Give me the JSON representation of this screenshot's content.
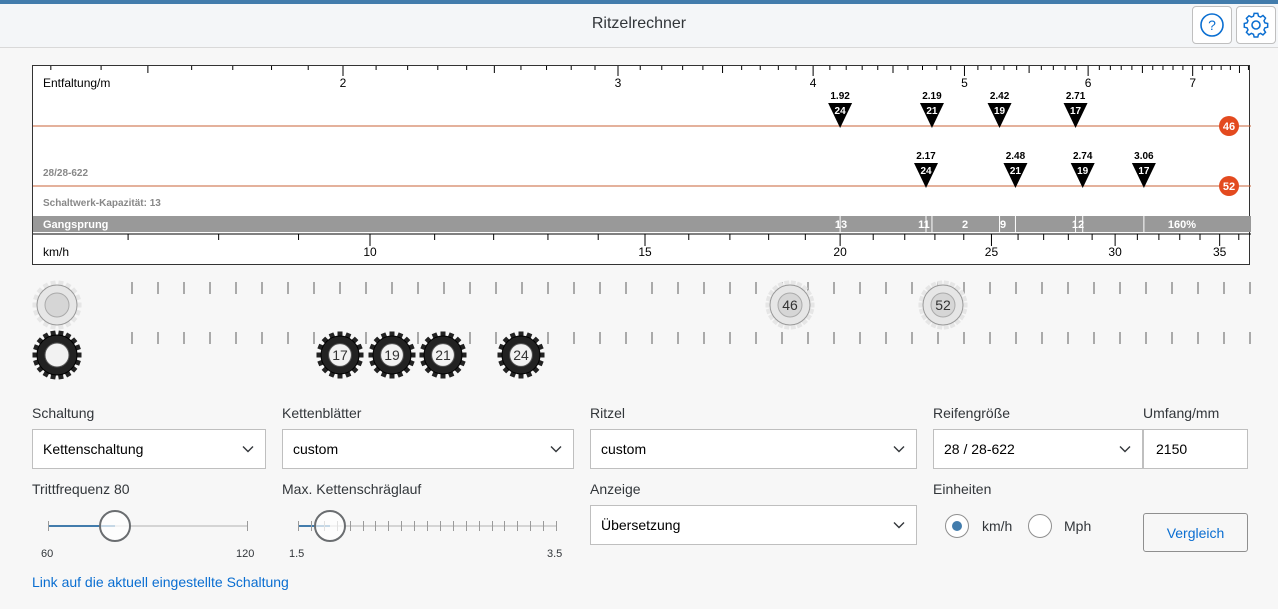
{
  "header": {
    "title": "Ritzelrechner",
    "help_icon": "help-icon",
    "settings_icon": "gear-icon"
  },
  "chart": {
    "top_axis_label": "Entfaltung/m",
    "top_ticks": [
      {
        "v": 1.5,
        "label": ""
      },
      {
        "v": 2,
        "label": "2"
      },
      {
        "v": 3,
        "label": "3"
      },
      {
        "v": 4,
        "label": "4"
      },
      {
        "v": 5,
        "label": "5"
      },
      {
        "v": 6,
        "label": "6"
      },
      {
        "v": 7,
        "label": "7"
      }
    ],
    "chainrings": [
      {
        "label": "46",
        "markers": [
          {
            "value": "1.92",
            "cog": "24",
            "kmh": 20.0
          },
          {
            "value": "2.19",
            "cog": "21",
            "kmh": 22.9
          },
          {
            "value": "2.42",
            "cog": "19",
            "kmh": 25.3
          },
          {
            "value": "2.71",
            "cog": "17",
            "kmh": 28.3
          }
        ]
      },
      {
        "label": "52",
        "markers": [
          {
            "value": "2.17",
            "cog": "24",
            "kmh": 22.7
          },
          {
            "value": "2.48",
            "cog": "21",
            "kmh": 25.9
          },
          {
            "value": "2.74",
            "cog": "19",
            "kmh": 28.6
          },
          {
            "value": "3.06",
            "cog": "17",
            "kmh": 31.3
          }
        ]
      }
    ],
    "tire_label": "28/28-622",
    "capacity_label": "Schaltwerk-Kapazität: 13",
    "gangsprung": {
      "label": "Gangsprung",
      "segments": [
        "13",
        "11",
        "2",
        "9",
        "12",
        "160%"
      ]
    },
    "bottom_axis_label": "km/h",
    "bottom_ticks": [
      {
        "v": 10,
        "label": "10"
      },
      {
        "v": 15,
        "label": "15"
      },
      {
        "v": 20,
        "label": "20"
      },
      {
        "v": 25,
        "label": "25"
      },
      {
        "v": 30,
        "label": "30"
      },
      {
        "v": 35,
        "label": "35"
      }
    ],
    "colors": {
      "ring_line": "#c8633a",
      "ring_badge": "#e34a1f",
      "marker": "#000000",
      "bar": "#999999"
    }
  },
  "gears": {
    "chainrings": [
      "46",
      "52"
    ],
    "cogs": [
      "17",
      "19",
      "21",
      "24"
    ]
  },
  "form": {
    "schaltung": {
      "label": "Schaltung",
      "value": "Kettenschaltung"
    },
    "kettenblaetter": {
      "label": "Kettenblätter",
      "value": "custom"
    },
    "ritzel": {
      "label": "Ritzel",
      "value": "custom"
    },
    "reifen": {
      "label": "Reifengröße",
      "value": "28 / 28-622"
    },
    "umfang": {
      "label": "Umfang/mm",
      "value": "2150"
    },
    "trittfrequenz": {
      "label": "Trittfrequenz 80",
      "min": "60",
      "max": "120",
      "value": 80
    },
    "schraeglauf": {
      "label": "Max. Kettenschräglauf",
      "min": "1.5",
      "max": "3.5",
      "value": 1.75
    },
    "anzeige": {
      "label": "Anzeige",
      "value": "Übersetzung"
    },
    "einheiten": {
      "label": "Einheiten",
      "options": [
        "km/h",
        "Mph"
      ],
      "selected": "km/h"
    },
    "vergleich_label": "Vergleich",
    "link_text": "Link auf die aktuell eingestellte Schaltung"
  }
}
